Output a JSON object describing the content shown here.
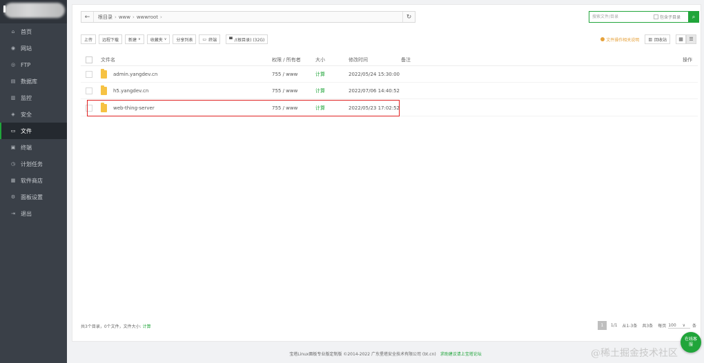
{
  "sidebar": {
    "items": [
      {
        "icon": "home-icon",
        "glyph": "⌂",
        "label": "首页"
      },
      {
        "icon": "globe-icon",
        "glyph": "◉",
        "label": "网站"
      },
      {
        "icon": "ftp-icon",
        "glyph": "◎",
        "label": "FTP"
      },
      {
        "icon": "database-icon",
        "glyph": "▤",
        "label": "数据库"
      },
      {
        "icon": "monitor-icon",
        "glyph": "▥",
        "label": "监控"
      },
      {
        "icon": "shield-icon",
        "glyph": "◈",
        "label": "安全"
      },
      {
        "icon": "folder-icon",
        "glyph": "▭",
        "label": "文件"
      },
      {
        "icon": "terminal-icon",
        "glyph": "▣",
        "label": "终端"
      },
      {
        "icon": "clock-icon",
        "glyph": "◷",
        "label": "计划任务"
      },
      {
        "icon": "apps-icon",
        "glyph": "▦",
        "label": "软件商店"
      },
      {
        "icon": "gear-icon",
        "glyph": "⚙",
        "label": "面板设置"
      },
      {
        "icon": "logout-icon",
        "glyph": "⇥",
        "label": "退出"
      }
    ],
    "active_index": 6
  },
  "pathbar": {
    "crumbs": [
      "根目录",
      "www",
      "wwwroot"
    ]
  },
  "search": {
    "placeholder": "搜索文件/目录",
    "sub_label": "包含子目录"
  },
  "toolbar": {
    "upload": "上传",
    "remote_download": "远程下载",
    "new": "新建",
    "favorites": "收藏夹",
    "share_list": "分享列表",
    "terminal": "终端",
    "root_usage": "/(根目录) (32G)",
    "warning": "文件操作相关说明",
    "recycle_bin": "回收站"
  },
  "table": {
    "headers": {
      "name": "文件名",
      "perm": "权限 / 所有者",
      "size": "大小",
      "time": "修改时间",
      "note": "备注",
      "op": "操作"
    },
    "rows": [
      {
        "name": "admin.yangdev.cn",
        "perm": "755 / www",
        "size": "计算",
        "time": "2022/05/24 15:30:00"
      },
      {
        "name": "h5.yangdev.cn",
        "perm": "755 / www",
        "size": "计算",
        "time": "2022/07/06 14:40:52"
      },
      {
        "name": "web-thing-server",
        "perm": "755 / www",
        "size": "计算",
        "time": "2022/05/23 17:02:52"
      }
    ]
  },
  "summary": {
    "text": "共3个目录，0个文件，文件大小:",
    "calc": "计算"
  },
  "pager": {
    "current": "1",
    "pages": "1/1",
    "range": "从1-3条",
    "total": "共3条",
    "per_page_label": "每页",
    "per_page": "100",
    "unit": "条"
  },
  "footer": {
    "text": "宝塔Linux面板专业版定制版 ©2014-2022 广东堡塔安全技术有限公司 (bt.cn)",
    "link": "求助建议请上宝塔论坛"
  },
  "service": {
    "label": "在线客服"
  },
  "watermark": "@稀土掘金技术社区",
  "colors": {
    "accent": "#20a53a",
    "sidebar_bg": "#3a4048",
    "warning": "#e6a23c",
    "highlight": "#e02020"
  }
}
